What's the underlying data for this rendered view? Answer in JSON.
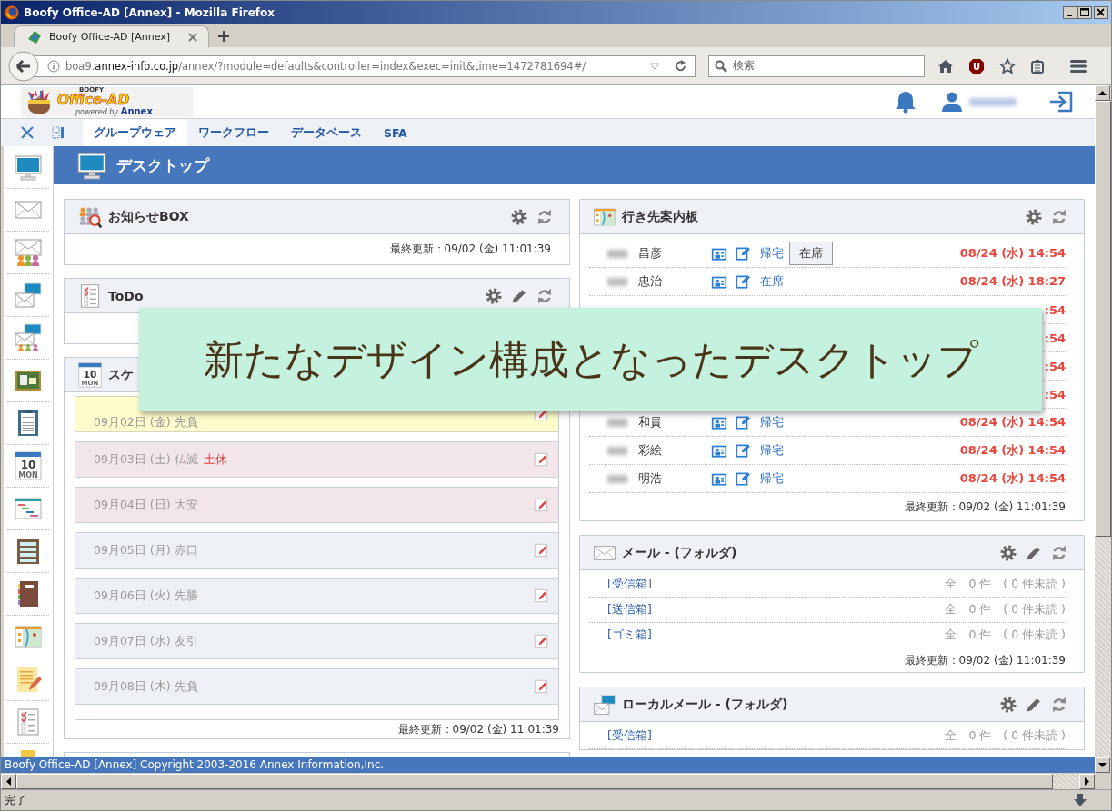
{
  "window": {
    "title": "Boofy Office-AD [Annex] - Mozilla Firefox"
  },
  "browser": {
    "tabs": [
      {
        "label": "Boofy Office-AD [Annex]",
        "selected": true
      }
    ],
    "address": {
      "subdomain": "boa9.",
      "domain": "annex-info.co.jp",
      "path": "/annex/?module=defaults&controller=index&exec=init&time=1472781694#/"
    },
    "search": {
      "placeholder": "検索"
    },
    "extension_badge": "U",
    "status": "完了"
  },
  "app": {
    "logo": {
      "top": "BOOFY",
      "name": "Office-AD",
      "byline": "powered by",
      "brand": "Annex"
    },
    "menu": [
      {
        "label": "グループウェア",
        "selected": true
      },
      {
        "label": "ワークフロー",
        "selected": false
      },
      {
        "label": "データベース",
        "selected": false
      },
      {
        "label": "SFA",
        "selected": false
      }
    ],
    "page_title": "デスクトップ",
    "sidebar_calendar_icon": {
      "day": "10",
      "weekday": "MON"
    },
    "left_panels": [
      {
        "kind": "notice",
        "title": "お知らせBOX",
        "editable": false,
        "updated": "最終更新：09/02 (金) 11:01:39"
      },
      {
        "kind": "todo",
        "title": "ToDo",
        "editable": true
      },
      {
        "kind": "schedule",
        "title": "スケ",
        "icon_text": {
          "day": "10",
          "weekday": "MON"
        },
        "updated": "最終更新：09/02 (金) 11:01:39",
        "rows": [
          {
            "date": "09月02日 (金) 先負",
            "kind": "today"
          },
          {
            "date": "09月03日 (土) 仏滅",
            "holiday": "土休",
            "kind": "weekend"
          },
          {
            "date": "09月04日 (日) 大安",
            "kind": "weekend"
          },
          {
            "date": "09月05日 (月) 赤口",
            "kind": "weekday"
          },
          {
            "date": "09月06日 (火) 先勝",
            "kind": "weekday"
          },
          {
            "date": "09月07日 (水) 友引",
            "kind": "weekday"
          },
          {
            "date": "09月08日 (木) 先負",
            "kind": "weekday"
          }
        ]
      }
    ],
    "right_panels": [
      {
        "kind": "whereabouts",
        "title": "行き先案内板",
        "editable": false,
        "updated": "最終更新：09/02 (金) 11:01:39",
        "rows": [
          {
            "name": "昌彦",
            "status": "帰宅",
            "button": "在席",
            "time": "08/24 (水) 14:54"
          },
          {
            "name": "忠治",
            "status": "在席",
            "time": "08/24 (水) 18:27"
          },
          {
            "time": ":54"
          },
          {
            "time": ":54"
          },
          {
            "time": ":54"
          },
          {
            "time": ":54"
          },
          {
            "name": "和貴",
            "status": "帰宅",
            "time": "08/24 (水) 14:54"
          },
          {
            "name": "彩絵",
            "status": "帰宅",
            "time": "08/24 (水) 14:54"
          },
          {
            "name": "明浩",
            "status": "帰宅",
            "time": "08/24 (水) 14:54"
          }
        ]
      },
      {
        "kind": "mail",
        "title": "メール - (フォルダ)",
        "editable": true,
        "updated": "最終更新：09/02 (金) 11:01:39",
        "folders": [
          {
            "name": "[受信箱]",
            "count": "全　0 件　( 0 件未読 )"
          },
          {
            "name": "[送信箱]",
            "count": "全　0 件　( 0 件未読 )"
          },
          {
            "name": "[ゴミ箱]",
            "count": "全　0 件　( 0 件未読 )"
          }
        ]
      },
      {
        "kind": "local_mail",
        "title": "ローカルメール - (フォルダ)",
        "editable": true,
        "folders": [
          {
            "name": "[受信箱]",
            "count": "全　0 件　( 0 件未読 )"
          }
        ]
      }
    ],
    "footer": "Boofy Office-AD [Annex] Copyright 2003-2016 Annex Information,Inc."
  },
  "banner": "新たなデザイン構成となったデスクトップ"
}
